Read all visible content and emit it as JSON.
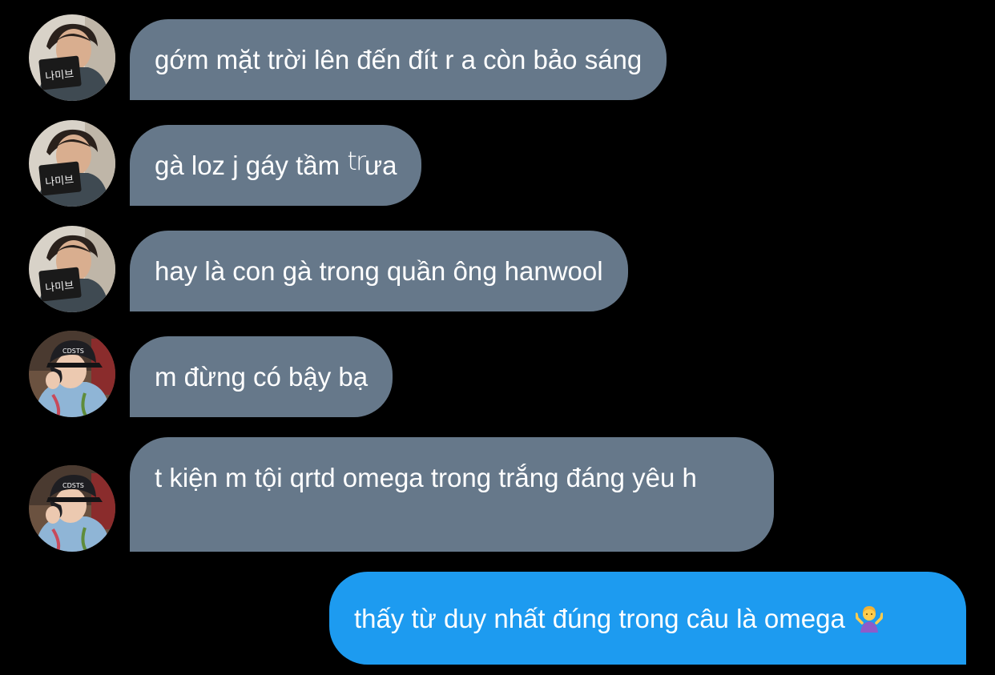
{
  "conversation": {
    "messages": [
      {
        "sender": "other",
        "avatar": "avatar-name-card",
        "text": "gớm mặt trời lên đến đít r a còn bảo sáng"
      },
      {
        "sender": "other",
        "avatar": "avatar-name-card",
        "text_before": "gà loz j gáy tầm ",
        "text_mark": "tr",
        "text_after": "ưa"
      },
      {
        "sender": "other",
        "avatar": "avatar-name-card",
        "text": "hay là con gà trong quần ông hanwool"
      },
      {
        "sender": "other",
        "avatar": "avatar-cap-boy",
        "text": "m đừng có bậy bạ"
      },
      {
        "sender": "other",
        "avatar": "avatar-cap-boy",
        "text": "t kiện m tội qrtd omega trong trắng đáng yêu h"
      },
      {
        "sender": "me",
        "text": "thấy từ duy nhất đúng trong câu là omega",
        "emoji": "person-shrugging-emoji"
      }
    ]
  },
  "colors": {
    "background": "#000000",
    "incoming_bubble": "#66788a",
    "outgoing_bubble": "#1d9bf0",
    "text": "#ffffff"
  }
}
